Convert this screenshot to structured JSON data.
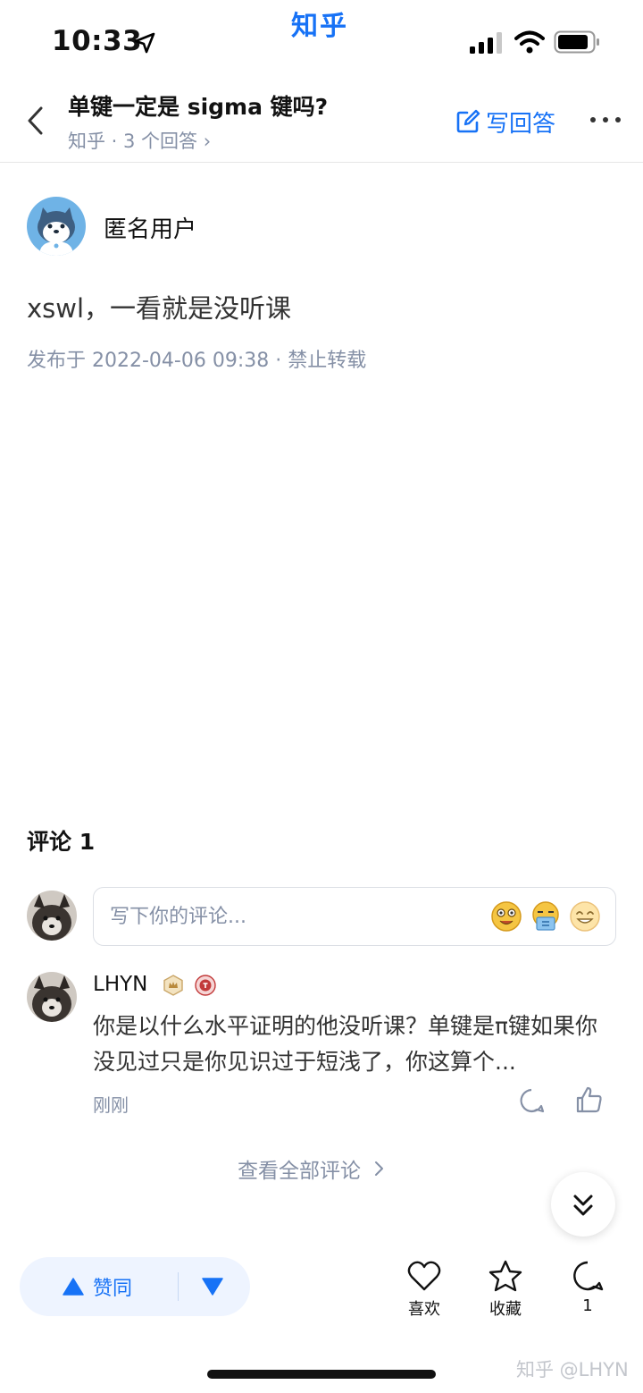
{
  "status_bar": {
    "time": "10:33",
    "carrier": "知乎"
  },
  "nav": {
    "question_title": "单键一定是 sigma 键吗?",
    "subtitle": "知乎 · 3 个回答 ›",
    "write_answer_label": "写回答"
  },
  "answer": {
    "author_name": "匿名用户",
    "content": "xswl，一看就是没听课",
    "meta": "发布于 2022-04-06 09:38 · 禁止转载"
  },
  "comments": {
    "heading": "评论 1",
    "input_placeholder": "写下你的评论...",
    "items": [
      {
        "user": "LHYN",
        "text": "你是以什么水平证明的他没听课？单键是π键如果你没见过只是你见识过于短浅了，你这算个...",
        "time": "刚刚"
      }
    ],
    "view_all_label": "查看全部评论"
  },
  "bottom_bar": {
    "vote_up_label": "赞同",
    "like_label": "喜欢",
    "collect_label": "收藏",
    "comment_count": "1"
  },
  "watermark": "知乎 @LHYN",
  "colors": {
    "accent": "#1772f6",
    "secondary_text": "#8590a6",
    "vote_bg": "#eef4ff"
  }
}
